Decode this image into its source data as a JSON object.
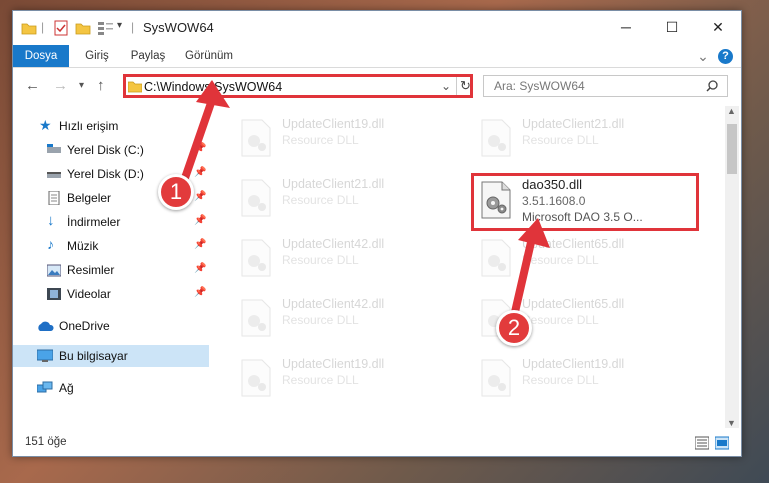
{
  "window": {
    "title": "SysWOW64",
    "controls": {
      "minimize": "─",
      "maximize": "☐",
      "close": "✕"
    }
  },
  "ribbon": {
    "tabs": [
      "Dosya",
      "Giriş",
      "Paylaş",
      "Görünüm"
    ],
    "help": "?",
    "expand": "⌄"
  },
  "navigation": {
    "address": "C:\\Windows\\SysWOW64",
    "search_placeholder": "Ara: SysWOW64"
  },
  "sidebar": {
    "items": [
      {
        "label": "Hızlı erişim",
        "icon": "star-icon"
      },
      {
        "label": "Yerel Disk (C:)",
        "icon": "drive-icon"
      },
      {
        "label": "Yerel Disk (D:)",
        "icon": "drive-icon"
      },
      {
        "label": "Belgeler",
        "icon": "documents-icon"
      },
      {
        "label": "İndirmeler",
        "icon": "download-icon"
      },
      {
        "label": "Müzik",
        "icon": "music-icon"
      },
      {
        "label": "Resimler",
        "icon": "pictures-icon"
      },
      {
        "label": "Videolar",
        "icon": "videos-icon"
      },
      {
        "label": "OneDrive",
        "icon": "cloud-icon"
      },
      {
        "label": "Bu bilgisayar",
        "icon": "computer-icon"
      },
      {
        "label": "Ağ",
        "icon": "network-icon"
      }
    ]
  },
  "files": {
    "left": [
      {
        "name": "UpdateClient19.dll",
        "desc": "Resource DLL"
      },
      {
        "name": "UpdateClient21.dll",
        "desc": "Resource DLL"
      },
      {
        "name": "UpdateClient42.dll",
        "desc": "Resource DLL"
      },
      {
        "name": "UpdateClient42.dll",
        "desc": "Resource DLL"
      },
      {
        "name": "UpdateClient19.dll",
        "desc": "Resource DLL"
      }
    ],
    "right": [
      {
        "name": "UpdateClient21.dll",
        "desc": "Resource DLL"
      },
      {
        "name": "UpdateClient65.dll",
        "desc": "Resource DLL"
      },
      {
        "name": "UpdateClient65.dll",
        "desc": "Resource DLL"
      },
      {
        "name": "UpdateClient19.dll",
        "desc": "Resource DLL"
      }
    ],
    "target": {
      "name": "dao350.dll",
      "version": "3.51.1608.0",
      "desc": "Microsoft DAO 3.5 O..."
    }
  },
  "status": {
    "count": "151 öğe"
  },
  "callouts": [
    "1",
    "2"
  ],
  "colors": {
    "accent": "#1979ca",
    "highlight": "#e0343a",
    "badge": "#e23b3c"
  }
}
